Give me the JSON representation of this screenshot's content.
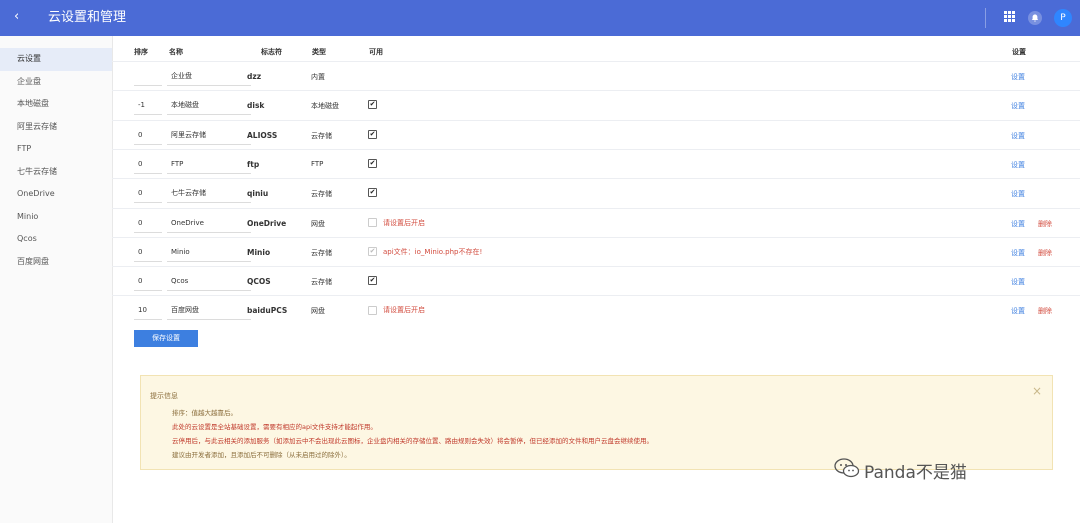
{
  "topbar": {
    "back_icon": "chevron-left-icon",
    "title": "云设置和管理",
    "avatar_letter": "P"
  },
  "sidebar": {
    "items": [
      {
        "label": "云设置",
        "active": true
      },
      {
        "label": "企业盘"
      },
      {
        "label": "本地磁盘"
      },
      {
        "label": "阿里云存储"
      },
      {
        "label": "FTP"
      },
      {
        "label": "七牛云存储"
      },
      {
        "label": "OneDrive"
      },
      {
        "label": "Minio"
      },
      {
        "label": "Qcos"
      },
      {
        "label": "百度网盘"
      }
    ]
  },
  "table": {
    "headers": {
      "sort": "排序",
      "name": "名称",
      "code": "标志符",
      "type": "类型",
      "available": "可用",
      "settings": "设置"
    },
    "rows": [
      {
        "sort": "",
        "name": "企业盘",
        "code": "dzz",
        "type": "内置",
        "checkbox": "none",
        "note": "",
        "set": "设置",
        "del": ""
      },
      {
        "sort": "-1",
        "name": "本地磁盘",
        "code": "disk",
        "type": "本地磁盘",
        "checkbox": "checked",
        "note": "",
        "set": "设置",
        "del": ""
      },
      {
        "sort": "0",
        "name": "阿里云存储",
        "code": "ALIOSS",
        "type": "云存储",
        "checkbox": "checked",
        "note": "",
        "set": "设置",
        "del": ""
      },
      {
        "sort": "0",
        "name": "FTP",
        "code": "ftp",
        "type": "FTP",
        "checkbox": "checked",
        "note": "",
        "set": "设置",
        "del": ""
      },
      {
        "sort": "0",
        "name": "七牛云存储",
        "code": "qiniu",
        "type": "云存储",
        "checkbox": "checked",
        "note": "",
        "set": "设置",
        "del": ""
      },
      {
        "sort": "0",
        "name": "OneDrive",
        "code": "OneDrive",
        "type": "网盘",
        "checkbox": "disabled",
        "note": "请设置后开启",
        "set": "设置",
        "del": "删除"
      },
      {
        "sort": "0",
        "name": "Minio",
        "code": "Minio",
        "type": "云存储",
        "checkbox": "disabled-checked",
        "note": "api文件：io_Minio.php不存在!",
        "set": "设置",
        "del": "删除"
      },
      {
        "sort": "0",
        "name": "Qcos",
        "code": "QCOS",
        "type": "云存储",
        "checkbox": "checked",
        "note": "",
        "set": "设置",
        "del": ""
      },
      {
        "sort": "10",
        "name": "百度网盘",
        "code": "baiduPCS",
        "type": "网盘",
        "checkbox": "disabled",
        "note": "请设置后开启",
        "set": "设置",
        "del": "删除"
      }
    ]
  },
  "save_label": "保存设置",
  "notice": {
    "title": "提示信息",
    "lines": [
      "排序：值越大越靠后。",
      "此处的云设置是全站基础设置，需要有相应的api文件支持才能起作用。",
      "云停用后，与此云相关的添加服务（如添加云中不会出现此云图标，企业盘内相关的存储位置、路由规则会失效）将会暂停，但已经添加的文件和用户云盘会继续使用。",
      "建议由开发者添加，且添加后不可删除（从未启用过的除外）。"
    ]
  },
  "watermark": "Panda不是猫",
  "colors": {
    "topbar": "#4b6bd6",
    "link": "#3d7fe0",
    "danger": "#d24b3e",
    "notice_bg": "#fdf7e3"
  }
}
